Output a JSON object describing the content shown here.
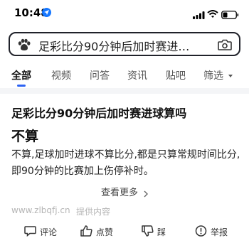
{
  "status_bar": {
    "time": "10:48"
  },
  "search": {
    "query": "足彩比分90分钟后加时赛进…"
  },
  "tabs": [
    {
      "label": "全部",
      "active": true
    },
    {
      "label": "视频"
    },
    {
      "label": "问答"
    },
    {
      "label": "资讯"
    },
    {
      "label": "贴吧"
    },
    {
      "label": "筛选"
    }
  ],
  "card": {
    "question": "足彩比分90分钟后加时赛进球算吗",
    "answer_title": "不算",
    "answer_body": "不算,足球加时进球不算比分,都是只算常规时间比分,即90分钟的比赛加上伤停补时。",
    "more_label": "查看更多",
    "source_domain": "www.zlbqfj.cn",
    "source_suffix": "提供内容"
  },
  "actions": {
    "comment": "评论",
    "like": "点赞",
    "dislike": "踩",
    "report": "举报"
  },
  "colors": {
    "accent": "#2d63f3",
    "location_icon": "#1677ff"
  }
}
